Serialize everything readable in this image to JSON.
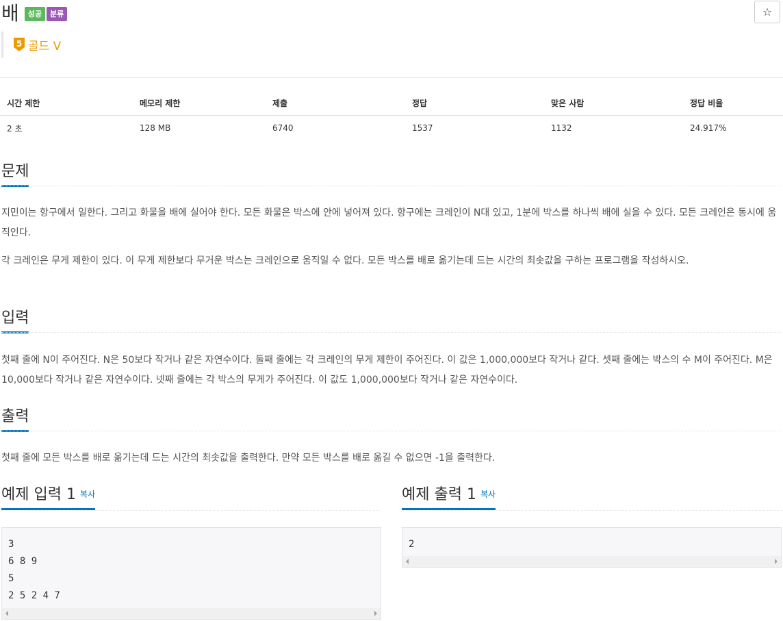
{
  "header": {
    "title": "배",
    "badges": {
      "success": "성공",
      "category": "분류"
    },
    "star_icon": "☆",
    "tier": {
      "number": "5",
      "label": "골드 V",
      "color": "#ec9a00"
    }
  },
  "stats": {
    "headers": [
      "시간 제한",
      "메모리 제한",
      "제출",
      "정답",
      "맞은 사람",
      "정답 비율"
    ],
    "values": [
      "2 초",
      "128 MB",
      "6740",
      "1537",
      "1132",
      "24.917%"
    ]
  },
  "sections": {
    "problem": {
      "title": "문제",
      "paragraphs": [
        "지민이는 항구에서 일한다. 그리고 화물을 배에 실어야 한다. 모든 화물은 박스에 안에 넣어져 있다. 항구에는 크레인이 N대 있고, 1분에 박스를 하나씩 배에 실을 수 있다. 모든 크레인은 동시에 움직인다.",
        "각 크레인은 무게 제한이 있다. 이 무게 제한보다 무거운 박스는 크레인으로 움직일 수 없다. 모든 박스를 배로 옮기는데 드는 시간의 최솟값을 구하는 프로그램을 작성하시오."
      ]
    },
    "input": {
      "title": "입력",
      "paragraph": "첫째 줄에 N이 주어진다. N은 50보다 작거나 같은 자연수이다. 둘째 줄에는 각 크레인의 무게 제한이 주어진다. 이 값은 1,000,000보다 작거나 같다. 셋째 줄에는 박스의 수 M이 주어진다. M은 10,000보다 작거나 같은 자연수이다. 넷째 줄에는 각 박스의 무게가 주어진다. 이 값도 1,000,000보다 작거나 같은 자연수이다."
    },
    "output": {
      "title": "출력",
      "paragraph": "첫째 줄에 모든 박스를 배로 옮기는데 드는 시간의 최솟값을 출력한다. 만약 모든 박스를 배로 옮길 수 없으면 -1을 출력한다."
    }
  },
  "samples": {
    "input": {
      "title": "예제 입력 1",
      "copy": "복사",
      "content": "3\n6 8 9\n5\n2 5 2 4 7"
    },
    "output": {
      "title": "예제 출력 1",
      "copy": "복사",
      "content": "2"
    }
  },
  "colors": {
    "accent": "#0076c0",
    "success": "#5cb85c",
    "category": "#9b59b6"
  }
}
